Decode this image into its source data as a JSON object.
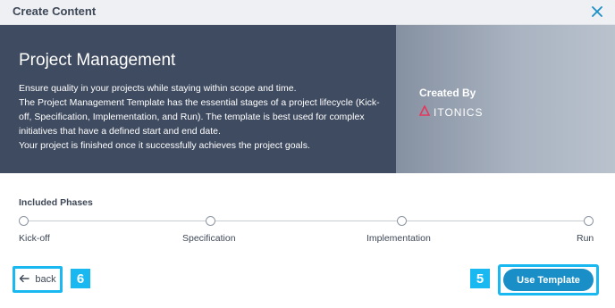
{
  "dialog": {
    "title": "Create Content",
    "close_icon": "close-icon"
  },
  "hero": {
    "title": "Project Management",
    "description": [
      "Ensure quality in your projects while staying within scope and time.",
      "The Project Management Template has the essential stages of a project lifecycle (Kick-off, Specification, Implementation, and Run). The template is best used for complex initiatives that have a defined start and end date.",
      "Your project is finished once it successfully achieves the project goals."
    ],
    "created_by_label": "Created By",
    "brand_name": "ITONICS",
    "brand_icon": "itonics-logo-icon",
    "brand_color": "#e8365c"
  },
  "phases": {
    "label": "Included Phases",
    "items": [
      "Kick-off",
      "Specification",
      "Implementation",
      "Run"
    ]
  },
  "footer": {
    "back_label": "back",
    "back_icon": "arrow-left-icon",
    "use_template_label": "Use Template",
    "badge_back": "6",
    "badge_use": "5"
  },
  "colors": {
    "accent": "#19b8f0",
    "primary_button": "#1a8fc7",
    "hero_dark": "#3f4b60"
  }
}
